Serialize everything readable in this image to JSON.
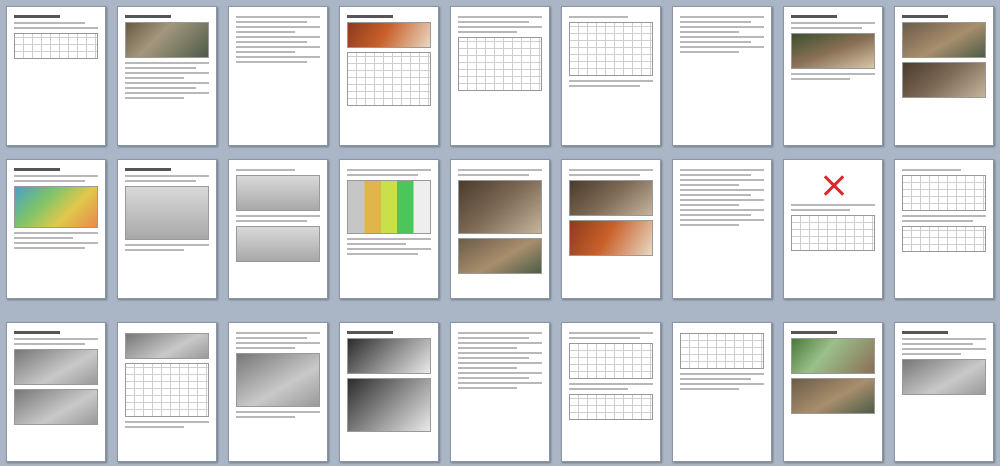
{
  "document": {
    "view": "thumbnail-grid",
    "columns": 9,
    "rows": 3,
    "page_count": 27
  }
}
